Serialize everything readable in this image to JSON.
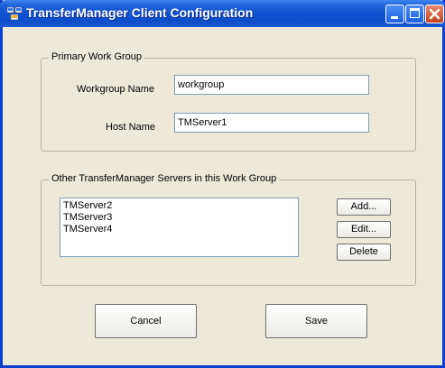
{
  "window": {
    "title": "TransferManager Client Configuration"
  },
  "primary_group": {
    "legend": "Primary Work Group",
    "workgroup_label": "Workgroup Name",
    "workgroup_value": "workgroup",
    "host_label": "Host Name",
    "host_value": "TMServer1"
  },
  "servers_group": {
    "legend": "Other TransferManager Servers in this Work Group",
    "servers": [
      "TMServer2",
      "TMServer3",
      "TMServer4"
    ],
    "add_label": "Add...",
    "edit_label": "Edit...",
    "delete_label": "Delete"
  },
  "footer": {
    "cancel_label": "Cancel",
    "save_label": "Save"
  }
}
